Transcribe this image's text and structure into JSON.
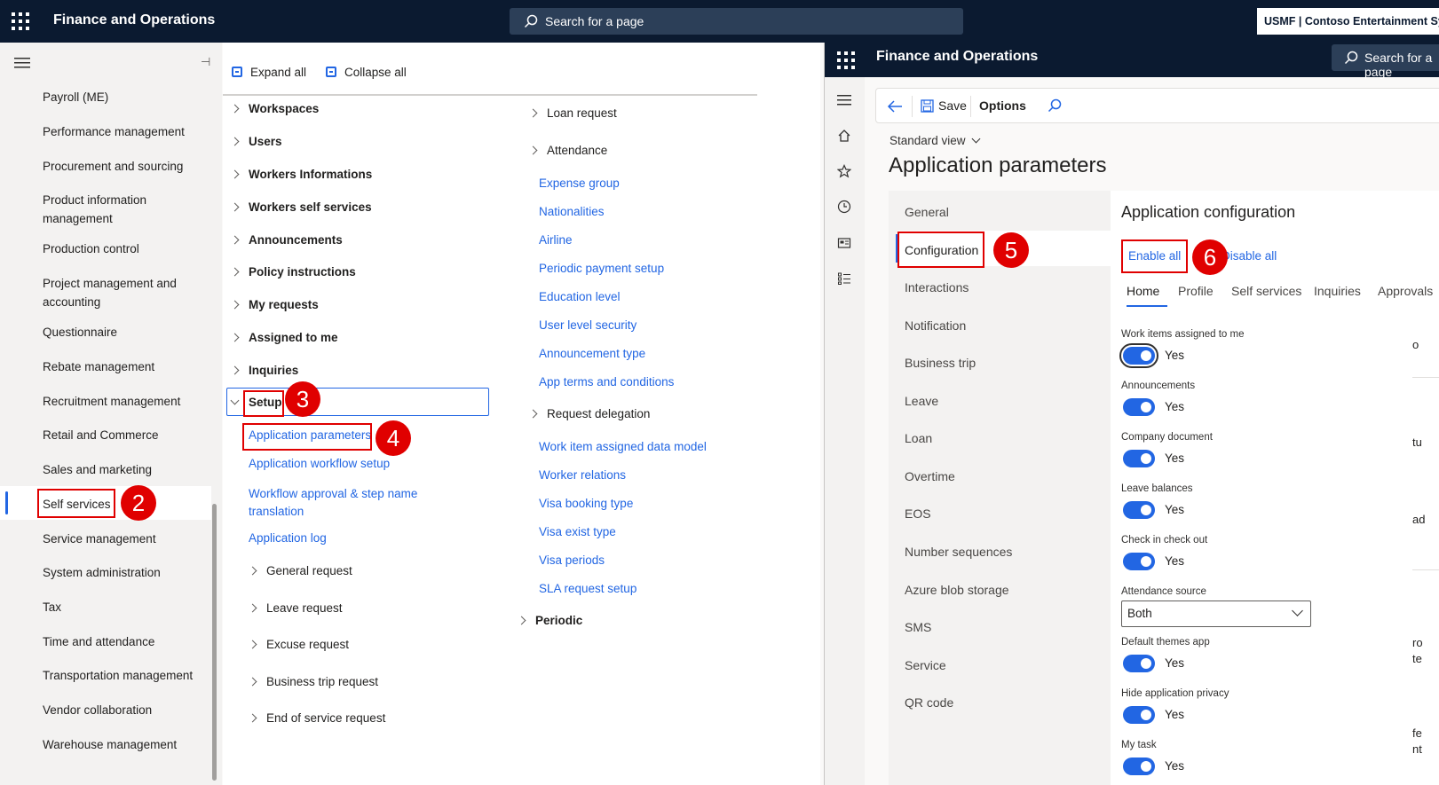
{
  "topbar": {
    "app_title": "Finance and Operations",
    "search_placeholder": "Search for a page",
    "company": "USMF | Contoso Entertainment System"
  },
  "leftnav": {
    "items": [
      {
        "label": "Payroll (ME)"
      },
      {
        "label": "Performance management"
      },
      {
        "label": "Procurement and sourcing"
      },
      {
        "label": "Product information management"
      },
      {
        "label": "Production control"
      },
      {
        "label": "Project management and accounting"
      },
      {
        "label": "Questionnaire"
      },
      {
        "label": "Rebate management"
      },
      {
        "label": "Recruitment management"
      },
      {
        "label": "Retail and Commerce"
      },
      {
        "label": "Sales and marketing"
      },
      {
        "label": "Self services",
        "selected": true
      },
      {
        "label": "Service management"
      },
      {
        "label": "System administration"
      },
      {
        "label": "Tax"
      },
      {
        "label": "Time and attendance"
      },
      {
        "label": "Transportation management"
      },
      {
        "label": "Vendor collaboration"
      },
      {
        "label": "Warehouse management"
      }
    ]
  },
  "modules": {
    "expand_all": "Expand all",
    "collapse_all": "Collapse all",
    "col1_groups": [
      "Workspaces",
      "Users",
      "Workers Informations",
      "Workers self services",
      "Announcements",
      "Policy instructions",
      "My requests",
      "Assigned to me",
      "Inquiries"
    ],
    "setup_label": "Setup",
    "setup_links": [
      "Application parameters",
      "Application workflow setup",
      "Workflow approval & step name translation",
      "Application log"
    ],
    "setup_subgroups": [
      "General request",
      "Leave request",
      "Excuse request",
      "Business trip request",
      "End of service request"
    ],
    "col2_subgroups_top": [
      "Loan request",
      "Attendance"
    ],
    "col2_links": [
      "Expense group",
      "Nationalities",
      "Airline",
      "Periodic payment setup",
      "Education level",
      "User level security",
      "Announcement type",
      "App terms and conditions"
    ],
    "col2_request_delegation": "Request delegation",
    "col2_links2": [
      "Work item assigned data model",
      "Worker relations",
      "Visa booking type",
      "Visa exist type",
      "Visa periods",
      "SLA request setup"
    ],
    "periodic_label": "Periodic"
  },
  "badges": {
    "b2": "2",
    "b3": "3",
    "b4": "4",
    "b5": "5",
    "b6": "6"
  },
  "rwin": {
    "app_title": "Finance and Operations",
    "search_text": "Search for a page",
    "save_label": "Save",
    "options_label": "Options",
    "standard_view": "Standard view",
    "page_title": "Application parameters",
    "vtabs": [
      "General",
      "Configuration",
      "Interactions",
      "Notification",
      "Business trip",
      "Leave",
      "Loan",
      "Overtime",
      "EOS",
      "Number sequences",
      "Azure blob storage",
      "SMS",
      "Service",
      "QR code"
    ],
    "section_title": "Application configuration",
    "enable_all": "Enable all",
    "disable_all": "Disable all",
    "htabs": [
      "Home",
      "Profile",
      "Self services",
      "Inquiries",
      "Approvals"
    ],
    "fields": [
      {
        "label": "Work items assigned to me",
        "value": "Yes"
      },
      {
        "label": "Announcements",
        "value": "Yes"
      },
      {
        "label": "Company document",
        "value": "Yes"
      },
      {
        "label": "Leave balances",
        "value": "Yes"
      },
      {
        "label": "Check in check out",
        "value": "Yes"
      }
    ],
    "attendance_source_label": "Attendance source",
    "attendance_source_value": "Both",
    "fields2": [
      {
        "label": "Default themes app",
        "value": "Yes"
      },
      {
        "label": "Hide application privacy",
        "value": "Yes"
      },
      {
        "label": "My task",
        "value": "Yes"
      }
    ],
    "cutoff_chars": [
      "o",
      "tu",
      "ad",
      "ro",
      "te",
      "fe",
      "nt"
    ]
  },
  "colors": {
    "accent": "#2266e3",
    "topbar": "#0b1a30",
    "annotation": "#e00000"
  }
}
